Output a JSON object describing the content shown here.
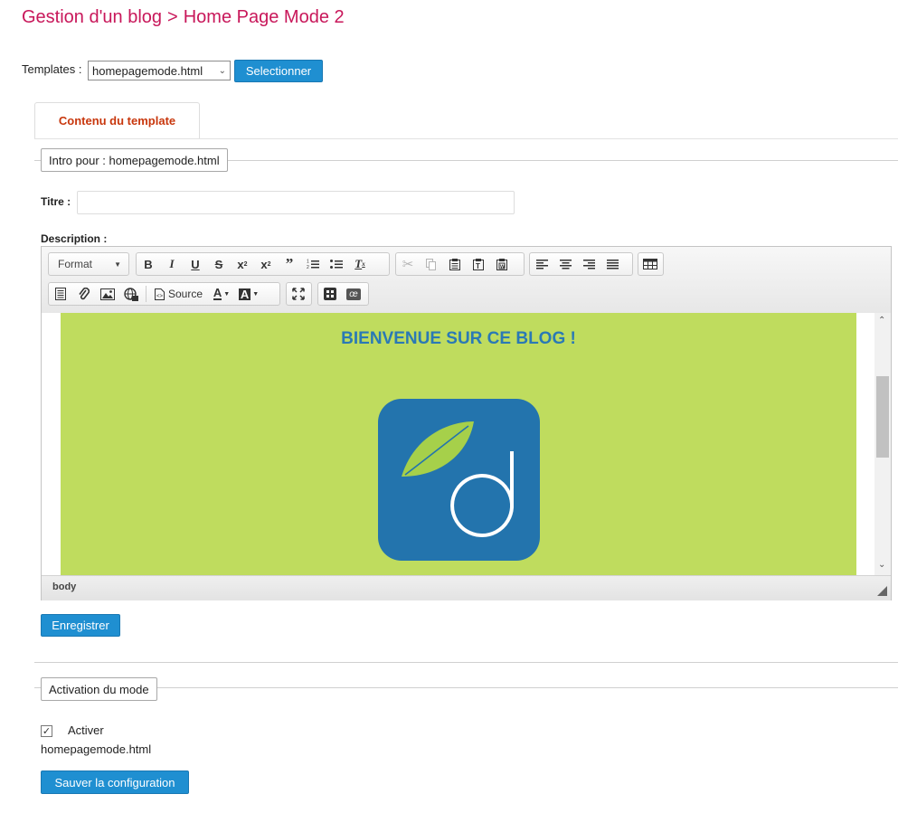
{
  "header": {
    "breadcrumb_root": "Gestion d'un blog",
    "breadcrumb_sep": ">",
    "breadcrumb_current": "Home Page Mode 2"
  },
  "templates": {
    "label": "Templates :",
    "selected": "homepagemode.html",
    "select_button": "Selectionner"
  },
  "tab": {
    "label": "Contenu du template"
  },
  "intro": {
    "legend": "Intro pour : homepagemode.html",
    "title_label": "Titre :",
    "title_value": "",
    "description_label": "Description :"
  },
  "editor": {
    "format_label": "Format",
    "source_label": "Source",
    "content_heading": "BIENVENUE SUR CE BLOG !",
    "status_path": "body",
    "logo_colors": {
      "bg": "#2374ad",
      "leaf": "#a6d04a",
      "letter": "#ffffff"
    },
    "content_bg": "#bfdc5e"
  },
  "save_button": "Enregistrer",
  "activation": {
    "legend": "Activation du mode",
    "checkbox_label": "Activer",
    "checked": true,
    "file": "homepagemode.html",
    "save_config_button": "Sauver la configuration"
  },
  "colors": {
    "title": "#c8175a",
    "button": "#1f8fd1",
    "tab_text": "#c8370d"
  }
}
